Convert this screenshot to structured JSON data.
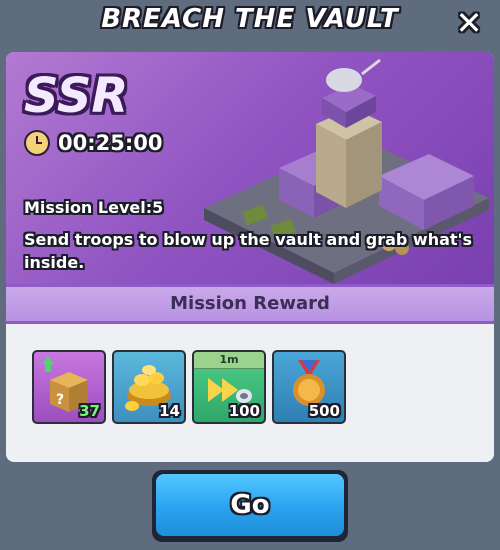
{
  "header": {
    "title": "BREACH THE VAULT",
    "close_label": "✕"
  },
  "mission": {
    "rarity": "SSR",
    "timer": "00:25:00",
    "level_label": "Mission Level:5",
    "description": "Send troops to blow up the vault and grab what's inside."
  },
  "rewards": {
    "title": "Mission Reward",
    "items": [
      {
        "icon": "mystery-box-icon",
        "count": "37",
        "count_color": "#7bf27a"
      },
      {
        "icon": "gold-coins-icon",
        "count": "14",
        "count_color": "#ffffff"
      },
      {
        "icon": "speedup-icon",
        "tag": "1m",
        "count": "100",
        "count_color": "#ffffff"
      },
      {
        "icon": "medal-icon",
        "count": "500",
        "count_color": "#ffffff"
      }
    ]
  },
  "actions": {
    "go_label": "Go"
  },
  "colors": {
    "background": "#5e6c7e",
    "banner": "#9256c3",
    "button": "#2aa3f0",
    "reward_bar": "#b892e2"
  }
}
